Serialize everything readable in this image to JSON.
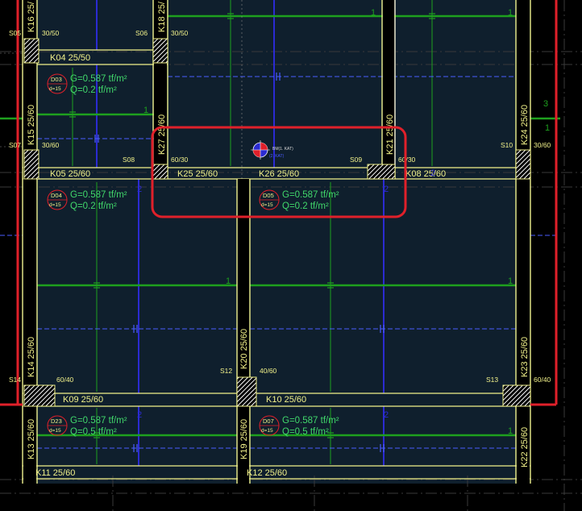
{
  "colors": {
    "background": "#000000",
    "slab_fill": "#0f1f2d",
    "beam_line": "#f2f28a",
    "column_fill": "#000000",
    "hatch": "#ffffff",
    "green_rebar": "#1ea01e",
    "green_text": "#41d86b",
    "blue_rebar": "#2b2bd2",
    "dim_line": "#4a5cff",
    "highlight": "#e0202a",
    "slab_circle": "#e0202a",
    "grid_line": "#444444",
    "small_text": "#d8d8d8"
  },
  "beams": {
    "k04": "K04 25/50",
    "k05": "K05 25/60",
    "k25": "K25 25/60",
    "k26": "K26 25/60",
    "k08": "K08 25/60",
    "k09": "K09 25/60",
    "k10": "K10 25/60",
    "k11": "K11 25/60",
    "k12": "K12 25/60"
  },
  "columns_labels": {
    "k16": "K16 25/",
    "k18": "K18 25/",
    "k15": "K15 25/60",
    "k27": "K27 25/60",
    "k21": "K21 25/60",
    "k24": "K24 25/60",
    "k14": "K14 25/60",
    "k20": "K20 25/60",
    "k23": "K23 25/60",
    "k13": "K13 25/60",
    "k19": "K19 25/60",
    "k22": "K22 25/60"
  },
  "supports": {
    "s05": "S05",
    "s06": "S06",
    "s07": "S07",
    "s08": "S08",
    "s09": "S09",
    "s10": "S10",
    "s12": "S12",
    "s13": "S13",
    "s14": "S14"
  },
  "column_sizes": {
    "c1": "30/50",
    "c2": "30/50",
    "c3": "30/60",
    "c4": "60/30",
    "c5": "60/30",
    "c6": "30/60",
    "c7": "60/40",
    "c8": "40/60",
    "c9": "60/40"
  },
  "slabs": {
    "d03": {
      "id": "D03",
      "d": "d=15",
      "g": "G=0.587 tf/m²",
      "q": "Q=0.2 tf/m²"
    },
    "d04": {
      "id": "D04",
      "d": "d=15",
      "g": "G=0.587 tf/m²",
      "q": "Q=0.2 tf/m²"
    },
    "d05": {
      "id": "D05",
      "d": "d=15",
      "g": "G=0.587 tf/m²",
      "q": "Q=0.2 tf/m²"
    },
    "d23": {
      "id": "D23",
      "d": "d=15",
      "g": "G=0.587 tf/m²",
      "q": "Q=0.5 tf/m²"
    },
    "d07": {
      "id": "D07",
      "d": "d=15",
      "g": "G=0.587 tf/m²",
      "q": "Q=0.5 tf/m²"
    }
  },
  "marker": {
    "label1": "BM(1. KAT)",
    "label2": "(2. KAT)"
  },
  "rebar_marks": {
    "one": "1",
    "two": "2",
    "three": "3"
  }
}
